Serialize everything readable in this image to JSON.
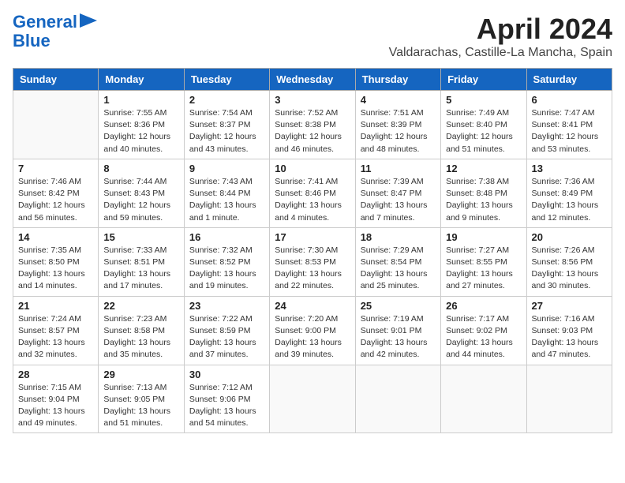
{
  "header": {
    "logo_line1": "General",
    "logo_line2": "Blue",
    "title": "April 2024",
    "subtitle": "Valdarachas, Castille-La Mancha, Spain"
  },
  "weekdays": [
    "Sunday",
    "Monday",
    "Tuesday",
    "Wednesday",
    "Thursday",
    "Friday",
    "Saturday"
  ],
  "weeks": [
    [
      {
        "day": null,
        "info": null
      },
      {
        "day": "1",
        "info": "Sunrise: 7:55 AM\nSunset: 8:36 PM\nDaylight: 12 hours\nand 40 minutes."
      },
      {
        "day": "2",
        "info": "Sunrise: 7:54 AM\nSunset: 8:37 PM\nDaylight: 12 hours\nand 43 minutes."
      },
      {
        "day": "3",
        "info": "Sunrise: 7:52 AM\nSunset: 8:38 PM\nDaylight: 12 hours\nand 46 minutes."
      },
      {
        "day": "4",
        "info": "Sunrise: 7:51 AM\nSunset: 8:39 PM\nDaylight: 12 hours\nand 48 minutes."
      },
      {
        "day": "5",
        "info": "Sunrise: 7:49 AM\nSunset: 8:40 PM\nDaylight: 12 hours\nand 51 minutes."
      },
      {
        "day": "6",
        "info": "Sunrise: 7:47 AM\nSunset: 8:41 PM\nDaylight: 12 hours\nand 53 minutes."
      }
    ],
    [
      {
        "day": "7",
        "info": "Sunrise: 7:46 AM\nSunset: 8:42 PM\nDaylight: 12 hours\nand 56 minutes."
      },
      {
        "day": "8",
        "info": "Sunrise: 7:44 AM\nSunset: 8:43 PM\nDaylight: 12 hours\nand 59 minutes."
      },
      {
        "day": "9",
        "info": "Sunrise: 7:43 AM\nSunset: 8:44 PM\nDaylight: 13 hours\nand 1 minute."
      },
      {
        "day": "10",
        "info": "Sunrise: 7:41 AM\nSunset: 8:46 PM\nDaylight: 13 hours\nand 4 minutes."
      },
      {
        "day": "11",
        "info": "Sunrise: 7:39 AM\nSunset: 8:47 PM\nDaylight: 13 hours\nand 7 minutes."
      },
      {
        "day": "12",
        "info": "Sunrise: 7:38 AM\nSunset: 8:48 PM\nDaylight: 13 hours\nand 9 minutes."
      },
      {
        "day": "13",
        "info": "Sunrise: 7:36 AM\nSunset: 8:49 PM\nDaylight: 13 hours\nand 12 minutes."
      }
    ],
    [
      {
        "day": "14",
        "info": "Sunrise: 7:35 AM\nSunset: 8:50 PM\nDaylight: 13 hours\nand 14 minutes."
      },
      {
        "day": "15",
        "info": "Sunrise: 7:33 AM\nSunset: 8:51 PM\nDaylight: 13 hours\nand 17 minutes."
      },
      {
        "day": "16",
        "info": "Sunrise: 7:32 AM\nSunset: 8:52 PM\nDaylight: 13 hours\nand 19 minutes."
      },
      {
        "day": "17",
        "info": "Sunrise: 7:30 AM\nSunset: 8:53 PM\nDaylight: 13 hours\nand 22 minutes."
      },
      {
        "day": "18",
        "info": "Sunrise: 7:29 AM\nSunset: 8:54 PM\nDaylight: 13 hours\nand 25 minutes."
      },
      {
        "day": "19",
        "info": "Sunrise: 7:27 AM\nSunset: 8:55 PM\nDaylight: 13 hours\nand 27 minutes."
      },
      {
        "day": "20",
        "info": "Sunrise: 7:26 AM\nSunset: 8:56 PM\nDaylight: 13 hours\nand 30 minutes."
      }
    ],
    [
      {
        "day": "21",
        "info": "Sunrise: 7:24 AM\nSunset: 8:57 PM\nDaylight: 13 hours\nand 32 minutes."
      },
      {
        "day": "22",
        "info": "Sunrise: 7:23 AM\nSunset: 8:58 PM\nDaylight: 13 hours\nand 35 minutes."
      },
      {
        "day": "23",
        "info": "Sunrise: 7:22 AM\nSunset: 8:59 PM\nDaylight: 13 hours\nand 37 minutes."
      },
      {
        "day": "24",
        "info": "Sunrise: 7:20 AM\nSunset: 9:00 PM\nDaylight: 13 hours\nand 39 minutes."
      },
      {
        "day": "25",
        "info": "Sunrise: 7:19 AM\nSunset: 9:01 PM\nDaylight: 13 hours\nand 42 minutes."
      },
      {
        "day": "26",
        "info": "Sunrise: 7:17 AM\nSunset: 9:02 PM\nDaylight: 13 hours\nand 44 minutes."
      },
      {
        "day": "27",
        "info": "Sunrise: 7:16 AM\nSunset: 9:03 PM\nDaylight: 13 hours\nand 47 minutes."
      }
    ],
    [
      {
        "day": "28",
        "info": "Sunrise: 7:15 AM\nSunset: 9:04 PM\nDaylight: 13 hours\nand 49 minutes."
      },
      {
        "day": "29",
        "info": "Sunrise: 7:13 AM\nSunset: 9:05 PM\nDaylight: 13 hours\nand 51 minutes."
      },
      {
        "day": "30",
        "info": "Sunrise: 7:12 AM\nSunset: 9:06 PM\nDaylight: 13 hours\nand 54 minutes."
      },
      {
        "day": null,
        "info": null
      },
      {
        "day": null,
        "info": null
      },
      {
        "day": null,
        "info": null
      },
      {
        "day": null,
        "info": null
      }
    ]
  ]
}
